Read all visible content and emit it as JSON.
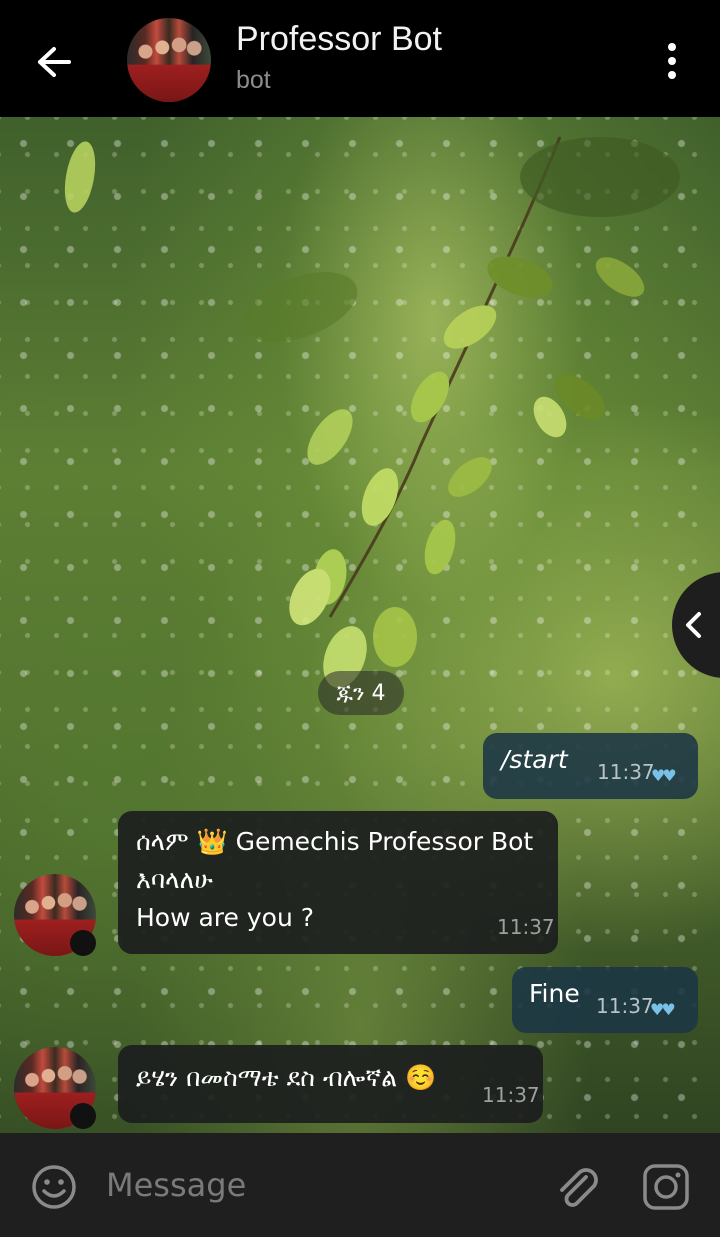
{
  "header": {
    "title": "Professor Bot",
    "subtitle": "bot"
  },
  "chat": {
    "date_label": "ጁን 4",
    "messages": [
      {
        "direction": "out",
        "text": "/start",
        "time": "11:37"
      },
      {
        "direction": "in",
        "text": "ሰላም 👑 Gemechis Professor Bot\nእባላለሁ\n  How are you ?",
        "time": "11:37"
      },
      {
        "direction": "out",
        "text": "Fine",
        "time": "11:37"
      },
      {
        "direction": "in",
        "text": "ይሄን በመስማቴ ደስ ብሎኛል ☺️",
        "time": "11:37"
      }
    ]
  },
  "input": {
    "placeholder": "Message"
  },
  "icons": {
    "back": "arrow-left-icon",
    "menu": "more-vertical-icon",
    "side_tab": "chevron-left-icon",
    "emoji": "smiley-icon",
    "attach": "paperclip-icon",
    "camera": "instagram-camera-icon",
    "read_receipt": "double-check-icon"
  },
  "colors": {
    "header_bg": "#000000",
    "outgoing_bubble": "#1b3646",
    "incoming_bubble": "#1c1e1e",
    "read_ticks": "#7ac1e8",
    "input_bar": "#1f1f1f"
  }
}
